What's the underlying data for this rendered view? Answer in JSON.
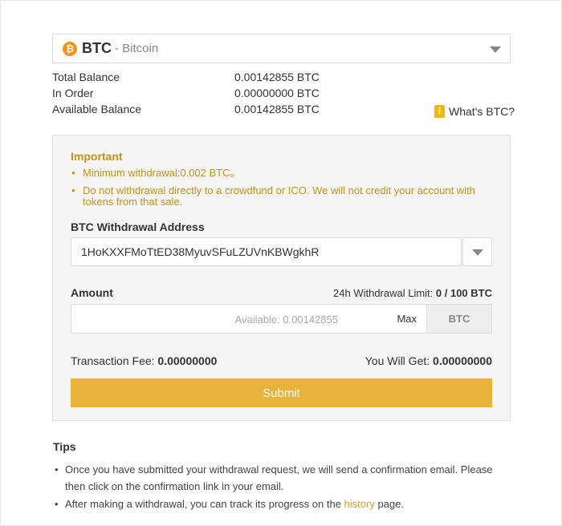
{
  "coin": {
    "logo_glyph": "₿",
    "symbol": "BTC",
    "name": "- Bitcoin"
  },
  "balances": [
    {
      "label": "Total Balance",
      "value": "0.00142855 BTC"
    },
    {
      "label": "In Order",
      "value": "0.00000000 BTC"
    },
    {
      "label": "Available Balance",
      "value": "0.00142855 BTC"
    }
  ],
  "whats_link": "What's BTC?",
  "whats_icon_glyph": "i",
  "important": {
    "title": "Important",
    "items": [
      "Minimum withdrawal:0.002 BTC。",
      "Do not withdrawal directly to a crowdfund or ICO. We will not credit your account with tokens from that sale."
    ]
  },
  "address": {
    "label": "BTC Withdrawal Address",
    "value": "1HoKXXFMoTtED38MyuvSFuLZUVnKBWgkhR"
  },
  "amount": {
    "label": "Amount",
    "limit_prefix": "24h Withdrawal Limit: ",
    "limit_value": "0 / 100 BTC",
    "placeholder": "Available: 0.00142855",
    "max_label": "Max",
    "unit": "BTC"
  },
  "fee": {
    "label": "Transaction Fee: ",
    "value": "0.00000000"
  },
  "receive": {
    "label": "You Will Get: ",
    "value": "0.00000000"
  },
  "submit_label": "Submit",
  "tips": {
    "title": "Tips",
    "item1": "Once you have submitted your withdrawal request, we will send a confirmation email. Please then click on the confirmation link in your email.",
    "item2_prefix": "After making a withdrawal, you can track its progress on the ",
    "item2_link": "history",
    "item2_suffix": " page."
  },
  "colors": {
    "accent": "#e8b23b",
    "important_text": "#c59416",
    "bitcoin": "#f7931a"
  }
}
